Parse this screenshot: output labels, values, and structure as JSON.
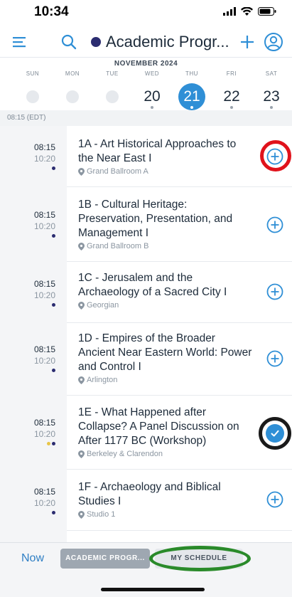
{
  "status_bar": {
    "time": "10:34"
  },
  "header": {
    "title": "Academic Progr...",
    "title_dot_color": "#2b2c70"
  },
  "calendar": {
    "month": "NOVEMBER 2024",
    "days": [
      {
        "name": "SUN",
        "num": ""
      },
      {
        "name": "MON",
        "num": ""
      },
      {
        "name": "TUE",
        "num": ""
      },
      {
        "name": "WED",
        "num": "20"
      },
      {
        "name": "THU",
        "num": "21",
        "selected": true
      },
      {
        "name": "FRI",
        "num": "22"
      },
      {
        "name": "SAT",
        "num": "23"
      }
    ]
  },
  "time_band": "08:15 (EDT)",
  "sessions": [
    {
      "start": "08:15",
      "end": "10:20",
      "title": "1A - Art Historical Approaches to the Near East I",
      "location": "Grand Ballroom A",
      "added": false
    },
    {
      "start": "08:15",
      "end": "10:20",
      "title": "1B - Cultural Heritage: Preservation, Presentation, and Management I",
      "location": "Grand Ballroom B",
      "added": false
    },
    {
      "start": "08:15",
      "end": "10:20",
      "title": "1C - Jerusalem and the Archaeology of a Sacred City I",
      "location": "Georgian",
      "added": false
    },
    {
      "start": "08:15",
      "end": "10:20",
      "title": "1D - Empires of the Broader Ancient Near Eastern World: Power and Control I",
      "location": "Arlington",
      "added": false
    },
    {
      "start": "08:15",
      "end": "10:20",
      "title": "1E - What Happened after Collapse? A Panel Discussion on After 1177 BC (Workshop)",
      "location": "Berkeley & Clarendon",
      "added": true
    },
    {
      "start": "08:15",
      "end": "10:20",
      "title": "1F - Archaeology and Biblical Studies I",
      "location": "Studio 1",
      "added": false
    }
  ],
  "bottom_bar": {
    "now_label": "Now",
    "tab_academic": "ACADEMIC PROGR...",
    "tab_my_schedule": "MY SCHEDULE"
  },
  "colors": {
    "accent": "#2f8fd6",
    "annotation_red": "#e0121b",
    "annotation_black": "#1a1a1a",
    "annotation_green": "#2a8a2a"
  }
}
